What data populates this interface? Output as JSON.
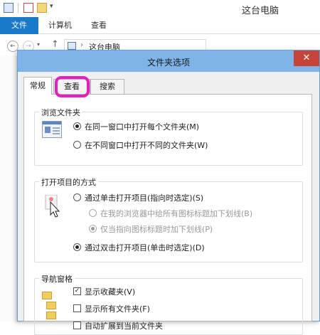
{
  "explorer": {
    "window_title": "这台电脑",
    "ribbon_tabs": [
      "文件",
      "计算机",
      "查看"
    ],
    "address_path": "这台电脑"
  },
  "dialog": {
    "title": "文件夹选项",
    "close_glyph": "✕",
    "tabs": [
      "常规",
      "查看",
      "搜索"
    ],
    "active_tab": "常规",
    "highlighted_tab": "查看",
    "groups": {
      "browse": {
        "legend": "浏览文件夹",
        "options": [
          {
            "label": "在同一窗口中打开每个文件夹(M)",
            "checked": true
          },
          {
            "label": "在不同窗口中打开不同的文件夹(W)",
            "checked": false
          }
        ]
      },
      "click": {
        "legend": "打开项目的方式",
        "options": [
          {
            "label": "通过单击打开项目(指向时选定)(S)",
            "checked": false
          },
          {
            "label": "在我的浏览器中给所有图标标题加下划线(B)",
            "checked": false,
            "disabled": true
          },
          {
            "label": "仅当指向图标标题时加下划线(P)",
            "checked": true,
            "disabled": true
          },
          {
            "label": "通过双击打开项目(单击时选定)(D)",
            "checked": true
          }
        ]
      },
      "nav": {
        "legend": "导航窗格",
        "options": [
          {
            "label": "显示收藏夹(V)",
            "checked": true
          },
          {
            "label": "显示所有文件夹(F)",
            "checked": false
          },
          {
            "label": "自动扩展到当前文件夹",
            "checked": false
          }
        ]
      }
    }
  },
  "colors": {
    "accent": "#1979ca",
    "dialog_titlebar": "#7fb4e6",
    "close_button": "#c7443a",
    "highlight_ring": "#e51fbf"
  }
}
